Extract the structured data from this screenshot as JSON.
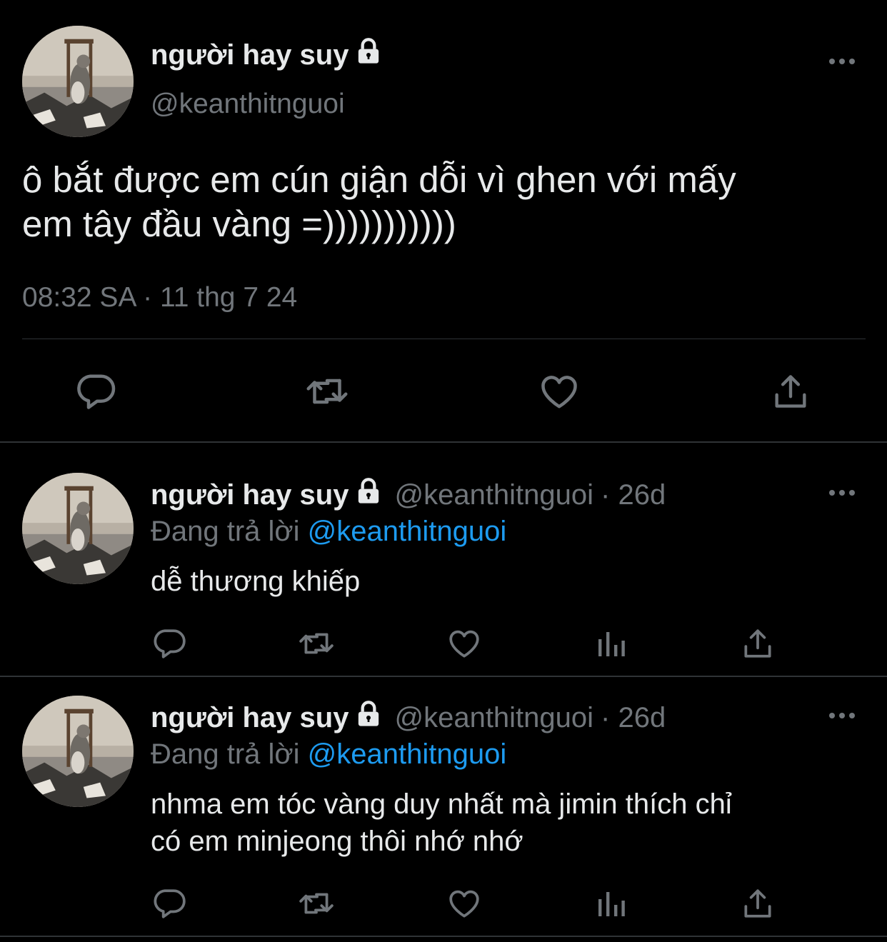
{
  "main_tweet": {
    "display_name": "người hay suy",
    "handle": "@keanthitnguoi",
    "text_line1": "ô bắt được em cún giận dỗi vì ghen với mấy",
    "text_line2": "em tây đầu vàng =)))))))))))",
    "timestamp": "08:32 SA · 11 thg 7 24",
    "actions": [
      "reply-icon",
      "retweet-icon",
      "like-icon",
      "share-icon"
    ]
  },
  "replies": [
    {
      "display_name": "người hay suy",
      "handle": "@keanthitnguoi",
      "age": "· 26d",
      "replying_label": "Đang trả lời",
      "replying_to": "@keanthitnguoi",
      "text_line1": "dễ thương khiếp",
      "text_line2": ""
    },
    {
      "display_name": "người hay suy",
      "handle": "@keanthitnguoi",
      "age": "· 26d",
      "replying_label": "Đang trả lời",
      "replying_to": "@keanthitnguoi",
      "text_line1": "nhma em tóc vàng duy nhất mà jimin thích chỉ",
      "text_line2": "có em minjeong thôi nhớ nhớ"
    }
  ],
  "colors": {
    "background": "#000000",
    "text": "#e7e9ea",
    "secondary": "#71767b",
    "mention": "#1d9bf0",
    "divider": "#2f3336"
  }
}
